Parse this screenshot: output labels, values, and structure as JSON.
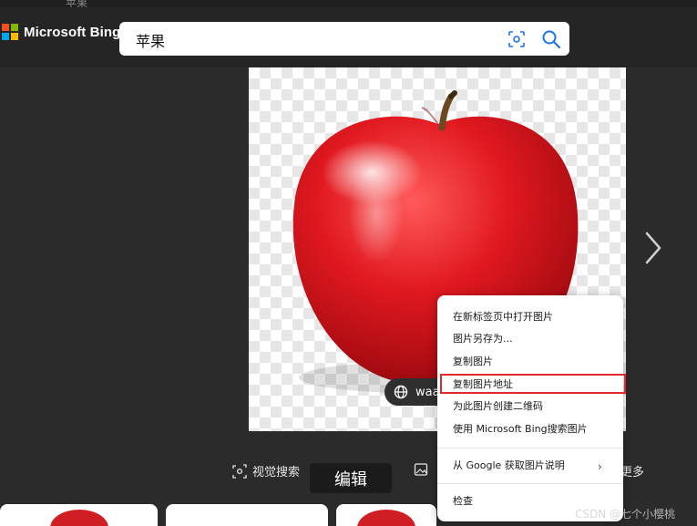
{
  "browser": {
    "tab_title": "苹果"
  },
  "header": {
    "brand": "Microsoft Bing",
    "search_value": "苹果",
    "brand_colors": [
      "#f25022",
      "#7fba00",
      "#00a4ef",
      "#ffb900"
    ]
  },
  "image": {
    "source_label": "waa"
  },
  "actions": {
    "visual_search": "视觉搜索",
    "save": "保存",
    "more": "更多",
    "edit_tooltip": "编辑"
  },
  "context_menu": {
    "open_in_new_tab": "在新标签页中打开图片",
    "save_as": "图片另存为...",
    "copy_image": "复制图片",
    "copy_image_address": "复制图片地址",
    "create_qr": "为此图片创建二维码",
    "search_with_bing": "使用 Microsoft Bing搜索图片",
    "google_describe": "从 Google 获取图片说明",
    "inspect": "检查"
  },
  "highlight_color": "#e0292a",
  "watermark": "CSDN @七个小樱桃"
}
